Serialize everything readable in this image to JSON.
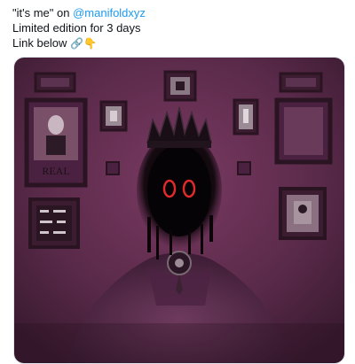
{
  "tweet": {
    "quote_text": "\"it's me\" on ",
    "mention": "@manifoldxyz",
    "line2": "Limited edition for 3 days",
    "line3_text": "Link below ",
    "line3_emoji_link": "🔗",
    "line3_emoji_point": "👇"
  },
  "media": {
    "frame_label": "REAL",
    "eye_label": "OO",
    "colors": {
      "wall": "#5a2a4a",
      "figure": "#0b0508",
      "eyes": "#e02a2a",
      "frame": "#2b1422"
    }
  }
}
